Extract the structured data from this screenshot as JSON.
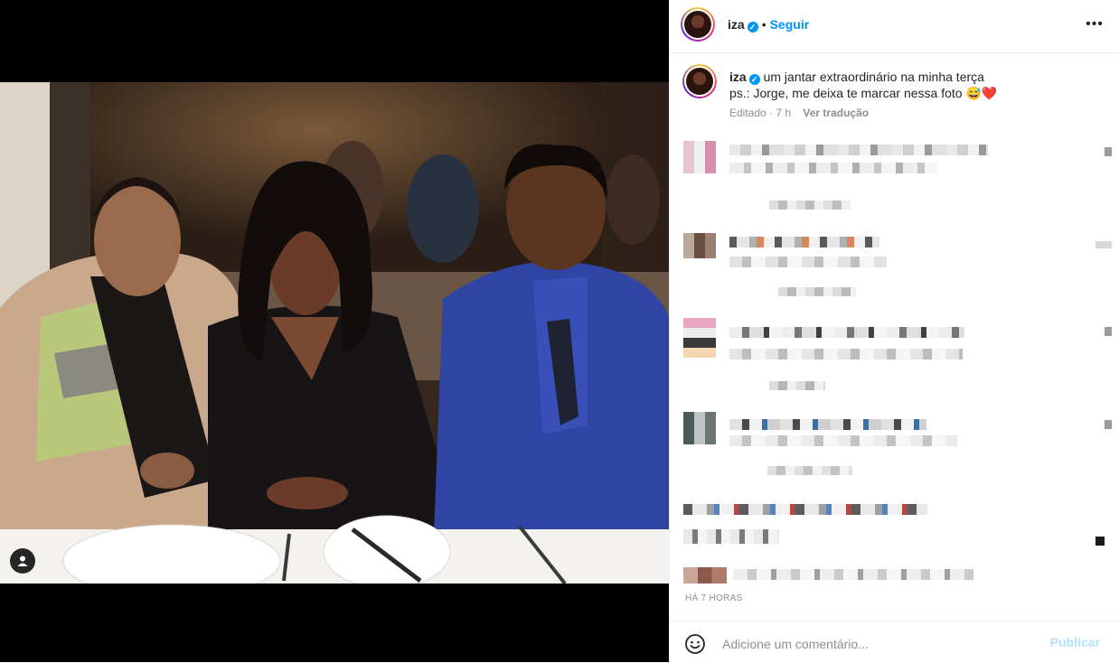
{
  "post": {
    "username": "iza",
    "follow_label": "Seguir",
    "dot": "•",
    "caption_line1": "um jantar extraordinário na minha terça",
    "caption_line2": "ps.: Jorge, me deixa te marcar nessa foto",
    "caption_emojis": "😅❤️",
    "edited_label": "Editado · 7 h",
    "translate_label": "Ver tradução",
    "timestamp_label": "HÁ 7 HORAS"
  },
  "composer": {
    "placeholder": "Adicione um comentário...",
    "publish_label": "Publicar"
  },
  "icons": {
    "more": "more-options-icon",
    "verified": "verified-badge-icon",
    "tag": "user-tag-icon",
    "emoji": "emoji-icon"
  },
  "colors": {
    "accent": "#0095f6",
    "publish_disabled": "#b2dffc",
    "meta": "#8e8e8e"
  }
}
